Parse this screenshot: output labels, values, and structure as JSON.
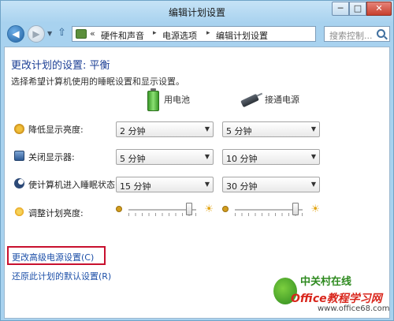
{
  "window": {
    "title": "编辑计划设置",
    "minimize_glyph": "─",
    "maximize_glyph": "□",
    "close_glyph": "✕"
  },
  "nav": {
    "back_glyph": "◀",
    "forward_glyph": "▶",
    "up_glyph": "⇧",
    "address_prefix": "«",
    "breadcrumbs": [
      "硬件和声音",
      "电源选项",
      "编辑计划设置"
    ],
    "breadcrumb_separator": "▸",
    "search_placeholder": "搜索控制..."
  },
  "content": {
    "heading": "更改计划的设置: 平衡",
    "subtext": "选择希望计算机使用的睡眠设置和显示设置。",
    "columns": {
      "battery": "用电池",
      "plugged_in": "接通电源"
    },
    "rows": [
      {
        "label": "降低显示亮度:",
        "icon": "dim-display-icon",
        "battery": "2 分钟",
        "plugged_in": "5 分钟"
      },
      {
        "label": "关闭显示器:",
        "icon": "display-icon",
        "battery": "5 分钟",
        "plugged_in": "10 分钟"
      },
      {
        "label": "使计算机进入睡眠状态:",
        "icon": "sleep-moon-icon",
        "battery": "15 分钟",
        "plugged_in": "30 分钟"
      }
    ],
    "brightness": {
      "label": "调整计划亮度:",
      "battery_level": 0.9,
      "plugged_in_level": 0.9
    },
    "links": {
      "advanced": "更改高级电源设置(C)",
      "restore": "还原此计划的默认设置(R)"
    }
  },
  "watermark": {
    "brand": "中关村在线",
    "site": "Office教程学习网",
    "url": "www.office68.com"
  },
  "colors": {
    "heading": "#1c3f95",
    "link": "#1c4fa8",
    "highlight": "#c8102e"
  }
}
